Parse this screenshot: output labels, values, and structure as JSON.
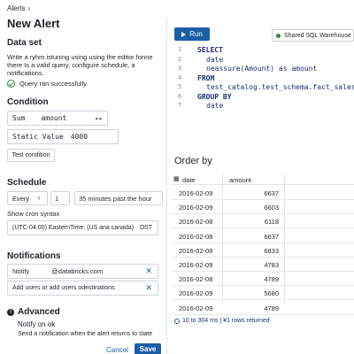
{
  "breadcrumb": {
    "label": "Alerts"
  },
  "page_title": "New Alert",
  "dataset": {
    "heading": "Data set",
    "description": "Write a ryhm istuning using using the editor fonne there Is a valid query, configure schedule, a notifications.",
    "status": "Query ran successfully"
  },
  "condition": {
    "heading": "Condition",
    "aggregation": "Sum",
    "column": "amount",
    "operator": "▸▸",
    "value_type": "Static Value",
    "value": "4000",
    "test_button": "Test condition"
  },
  "schedule": {
    "heading": "Schedule",
    "every_label": "Every",
    "every_stepper": "4",
    "interval": "1",
    "offset": "35 minutes past the hour",
    "cron_link": "Show cron syntax",
    "timezone": "(UTC-04:00) EasternTime: (US ana canada)",
    "timezone_suffix": "DST"
  },
  "notifications": {
    "heading": "Notifications",
    "notify_label": "Notify",
    "email": "@databricks.com",
    "add_placeholder": "Add users or add users odestinations"
  },
  "advanced": {
    "heading": "Advanced",
    "notify_on": "Notify on ok",
    "notify_desc": "Send a notification  when the alert returns to state"
  },
  "actions": {
    "cancel": "Cancel",
    "save": "Save"
  },
  "editor": {
    "run_label": "Run",
    "warehouse": "Shared SQL Warehouse",
    "lines": [
      {
        "n": "1",
        "text": "SELECT",
        "kw": true,
        "indent": 0
      },
      {
        "n": "2",
        "text": "date",
        "kw": false,
        "indent": 1
      },
      {
        "n": "3",
        "text": "neassure(Amount) as amount",
        "kw": false,
        "indent": 1
      },
      {
        "n": "4",
        "text": "FROM",
        "kw": true,
        "indent": 0
      },
      {
        "n": "5",
        "text": "test_catalog.test_schema.fact_sales_m6t",
        "kw": false,
        "indent": 1
      },
      {
        "n": "6",
        "text": "GROUP BY",
        "kw": true,
        "indent": 0
      },
      {
        "n": "7",
        "text": "date",
        "kw": false,
        "indent": 1
      }
    ]
  },
  "results": {
    "heading": "Order by",
    "columns": [
      "date",
      "amount"
    ],
    "rows": [
      [
        "2016-02-09",
        "6637"
      ],
      [
        "2016-02-09",
        "6603"
      ],
      [
        "2016-02-08",
        "6118"
      ],
      [
        "2016-02-08",
        "6637"
      ],
      [
        "2016-02-08",
        "6833"
      ],
      [
        "2016-02-09",
        "4783"
      ],
      [
        "2016-02-08",
        "4789"
      ],
      [
        "2016-02-09",
        "5680"
      ],
      [
        "2016-02-09",
        "4789"
      ]
    ],
    "footer": "10 to 304 ms | ¥1 rows returned"
  }
}
